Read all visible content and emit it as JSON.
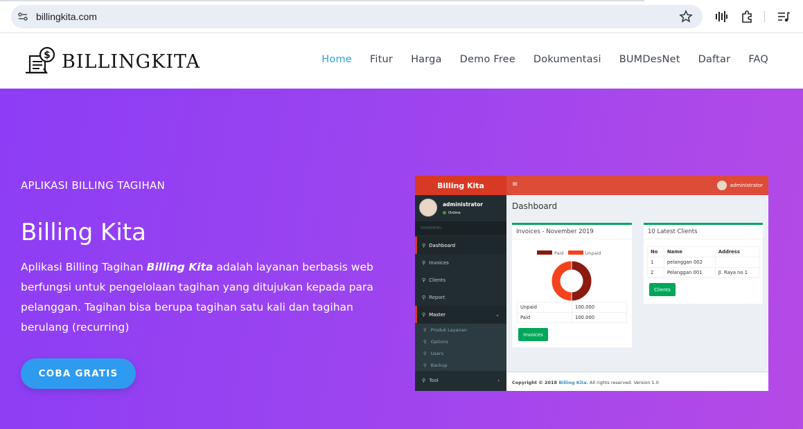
{
  "browser": {
    "url": "billingkita.com",
    "icons": [
      "site-info-icon",
      "bookmark-star-icon",
      "media-icon",
      "extensions-icon",
      "reading-list-icon"
    ]
  },
  "site": {
    "logo_text": "BILLINGKITA",
    "nav": [
      {
        "label": "Home",
        "active": true
      },
      {
        "label": "Fitur",
        "active": false
      },
      {
        "label": "Harga",
        "active": false
      },
      {
        "label": "Demo Free",
        "active": false
      },
      {
        "label": "Dokumentasi",
        "active": false
      },
      {
        "label": "BUMDesNet",
        "active": false
      },
      {
        "label": "Daftar",
        "active": false
      },
      {
        "label": "FAQ",
        "active": false
      }
    ]
  },
  "hero": {
    "eyebrow": "APLIKASI BILLING TAGIHAN",
    "title": "Billing Kita",
    "desc_pre": "Aplikasi Billing Tagihan ",
    "desc_em": "Billing Kita",
    "desc_post": " adalah layanan berbasis web berfungsi untuk pengelolaan tagihan yang ditujukan kepada para pelanggan. Tagihan bisa berupa tagihan satu kali dan tagihan berulang (recurring)",
    "cta": "COBA GRATIS",
    "colors": {
      "gradient_start": "#8d3df5",
      "gradient_end": "#b54ae6",
      "cta": "#2e9bf0"
    }
  },
  "dashboard": {
    "brand": "Billing Kita",
    "user": "administrator",
    "status": "Online",
    "menu_header": "MAINMENU",
    "menu": [
      "Dashboard",
      "Invoices",
      "Clients",
      "Report",
      "Master"
    ],
    "submenu": [
      "Produk Layanan",
      "Options",
      "Users",
      "Backup"
    ],
    "tool": "Tool",
    "page_title": "Dashboard",
    "invoices_box": {
      "title": "Invoices - November 2019",
      "legend": [
        "Paid",
        "Unpaid"
      ],
      "rows": [
        [
          "Unpaid",
          "100.000"
        ],
        [
          "Paid",
          "100.000"
        ]
      ],
      "button": "Invoices"
    },
    "clients_box": {
      "title": "10 Latest Clients",
      "headers": [
        "No",
        "Name",
        "Address"
      ],
      "rows": [
        [
          "1",
          "pelanggan 002",
          ""
        ],
        [
          "2",
          "Pelanggan 001",
          "Jl. Raya no 1"
        ]
      ],
      "button": "Clients"
    },
    "footer_pre": "Copyright © 2018 ",
    "footer_link": "Billing Kita.",
    "footer_post": " All rights reserved. Version 1.0",
    "chart_data": {
      "type": "pie",
      "categories": [
        "Paid",
        "Unpaid"
      ],
      "values": [
        100000,
        100000
      ],
      "colors": [
        "#8b1a10",
        "#f5421e"
      ]
    }
  }
}
